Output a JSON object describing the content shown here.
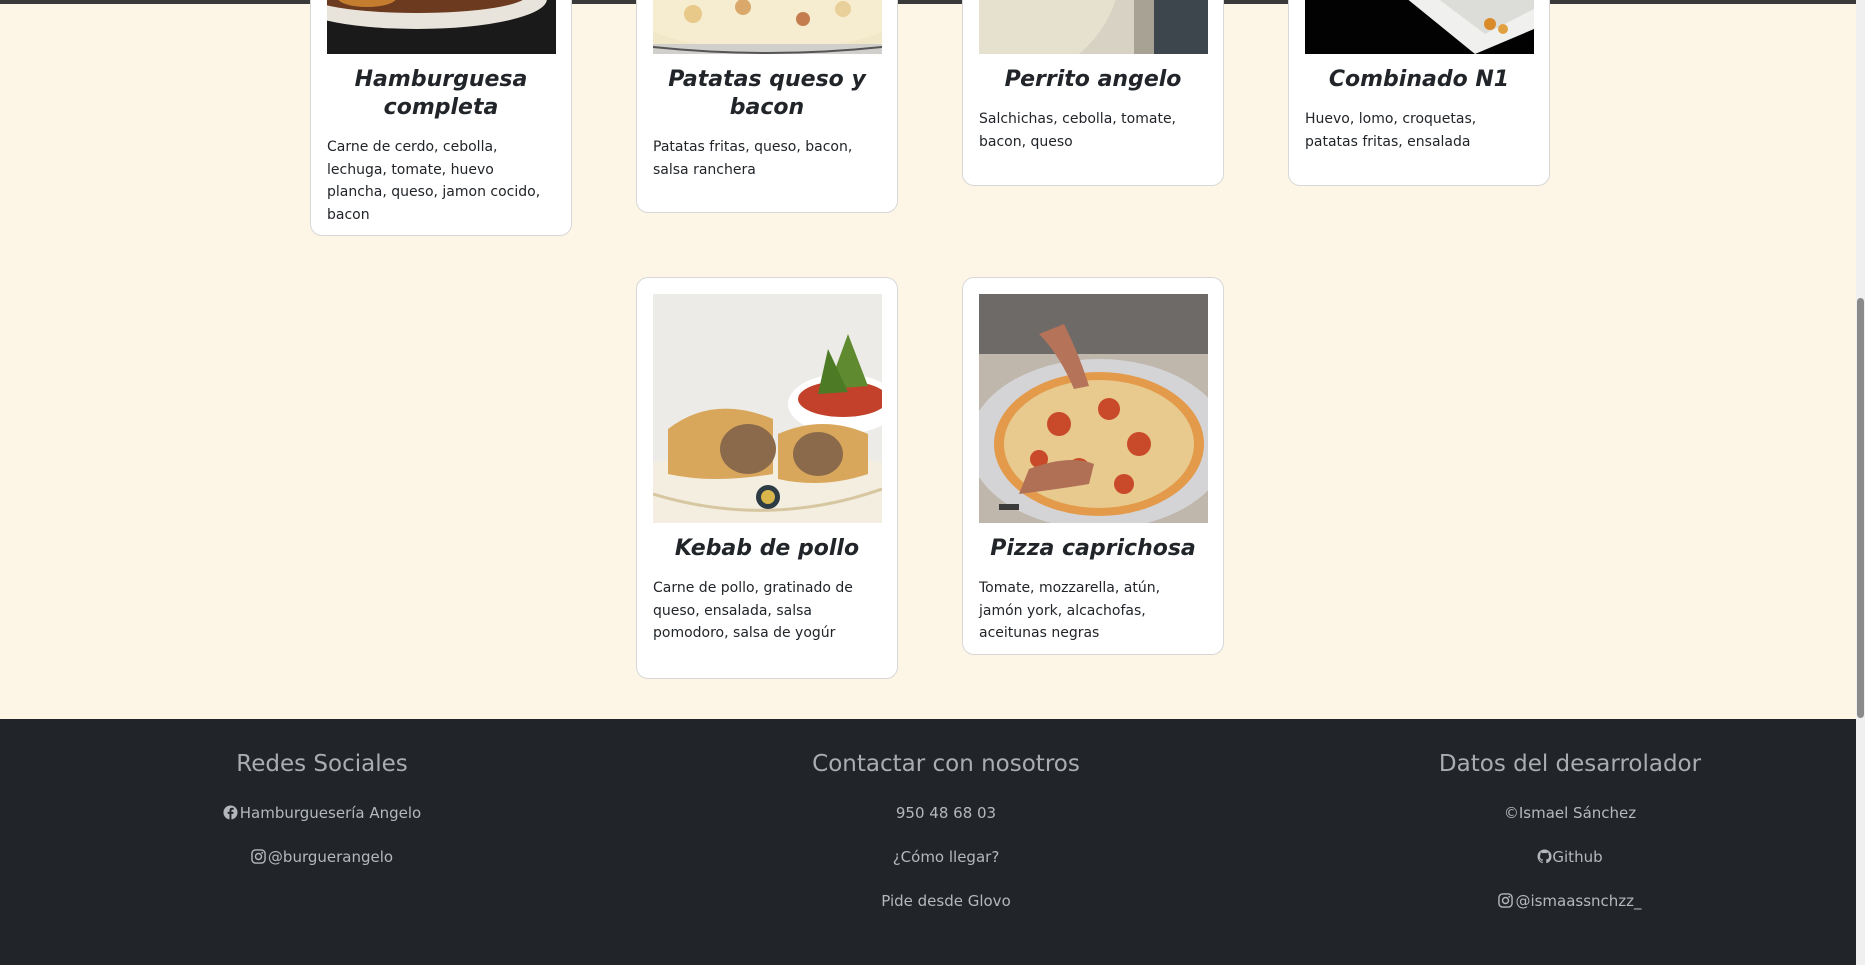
{
  "cards": [
    {
      "title": "Hamburguesa completa",
      "desc": "Carne de cerdo, cebolla, lechuga, tomate, huevo plancha, queso, jamon cocido, bacon"
    },
    {
      "title": "Patatas queso y bacon",
      "desc": "Patatas fritas, queso, bacon, salsa ranchera"
    },
    {
      "title": "Perrito angelo",
      "desc": "Salchichas, cebolla, tomate, bacon, queso"
    },
    {
      "title": "Combinado N1",
      "desc": "Huevo, lomo, croquetas, patatas fritas, ensalada"
    },
    {
      "title": "Kebab de pollo",
      "desc": "Carne de pollo, gratinado de queso, ensalada, salsa pomodoro, salsa de yogúr"
    },
    {
      "title": "Pizza caprichosa",
      "desc": "Tomate, mozzarella, atún, jamón york, alcachofas, aceitunas negras"
    }
  ],
  "footer": {
    "social": {
      "heading": "Redes Sociales",
      "facebook": "Hamburguesería Angelo",
      "instagram": "@burguerangelo"
    },
    "contact": {
      "heading": "Contactar con nosotros",
      "phone": "950 48 68 03",
      "directions": "¿Cómo llegar?",
      "glovo": "Pide desde Glovo"
    },
    "developer": {
      "heading": "Datos del desarrolador",
      "copyright": "©Ismael Sánchez",
      "github": "Github",
      "instagram": "@ismaassnchzz_"
    }
  },
  "colors": {
    "page_bg": "#fdf5e6",
    "footer_bg": "#212529",
    "card_bg": "#ffffff"
  }
}
